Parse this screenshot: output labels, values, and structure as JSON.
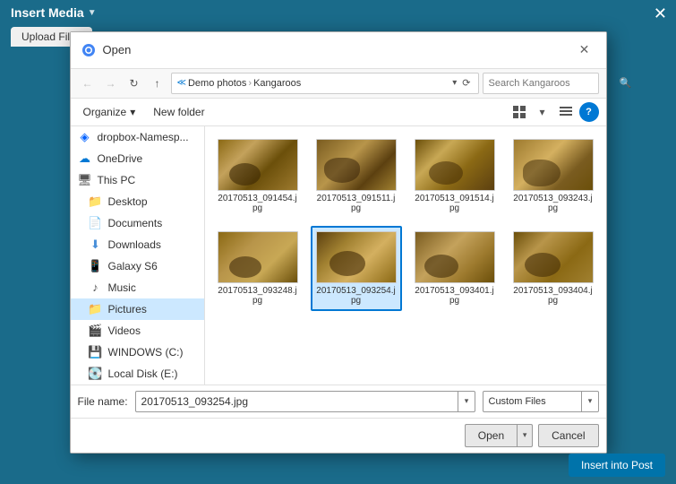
{
  "app": {
    "title": "Insert Media",
    "title_arrow": "▼",
    "close_label": "✕"
  },
  "dialog": {
    "title": "Open",
    "close_label": "✕",
    "nav": {
      "back_label": "←",
      "forward_label": "→",
      "recent_label": "↻",
      "up_label": "↑",
      "breadcrumbs": [
        "Demo photos",
        "Kangaroos"
      ],
      "search_placeholder": "Search Kangaroos",
      "refresh_label": "⟳"
    },
    "toolbar": {
      "organize_label": "Organize",
      "organize_arrow": "▾",
      "new_folder_label": "New folder",
      "view_grid_label": "⊞",
      "view_list_label": "☰",
      "help_label": "?"
    },
    "sidebar": {
      "items": [
        {
          "id": "dropbox",
          "icon": "dropbox",
          "label": "dropbox-Namesp..."
        },
        {
          "id": "onedrive",
          "icon": "onedrive",
          "label": "OneDrive"
        },
        {
          "id": "this-pc",
          "icon": "pc",
          "label": "This PC",
          "is_parent": true
        },
        {
          "id": "desktop",
          "icon": "folder",
          "label": "Desktop",
          "indent": true
        },
        {
          "id": "documents",
          "icon": "folder-doc",
          "label": "Documents",
          "indent": true
        },
        {
          "id": "downloads",
          "icon": "folder-down",
          "label": "Downloads",
          "indent": true
        },
        {
          "id": "galaxy-s6",
          "icon": "phone",
          "label": "Galaxy S6",
          "indent": true
        },
        {
          "id": "music",
          "icon": "music",
          "label": "Music",
          "indent": true
        },
        {
          "id": "pictures",
          "icon": "folder",
          "label": "Pictures",
          "indent": true,
          "active": true
        },
        {
          "id": "videos",
          "icon": "video",
          "label": "Videos",
          "indent": true
        },
        {
          "id": "windows-c",
          "icon": "drive",
          "label": "WINDOWS (C:)",
          "indent": true
        },
        {
          "id": "local-disk-e",
          "icon": "drive",
          "label": "Local Disk (E:)",
          "indent": true
        }
      ]
    },
    "files": [
      {
        "id": "f1",
        "name": "20170513_091454.jpg",
        "thumb_class": "thumb-1"
      },
      {
        "id": "f2",
        "name": "20170513_091511.jpg",
        "thumb_class": "thumb-2"
      },
      {
        "id": "f3",
        "name": "20170513_091514.jpg",
        "thumb_class": "thumb-3"
      },
      {
        "id": "f4",
        "name": "20170513_093243.jpg",
        "thumb_class": "thumb-4"
      },
      {
        "id": "f5",
        "name": "20170513_093248.jpg",
        "thumb_class": "thumb-5"
      },
      {
        "id": "f6",
        "name": "20170513_093254.jpg",
        "thumb_class": "thumb-6",
        "selected": true
      },
      {
        "id": "f7",
        "name": "20170513_093401.jpg",
        "thumb_class": "thumb-7"
      },
      {
        "id": "f8",
        "name": "20170513_093404.jpg",
        "thumb_class": "thumb-8"
      }
    ],
    "bottom": {
      "filename_label": "File name:",
      "filename_value": "20170513_093254.jpg",
      "filetype_label": "Custom Files",
      "open_label": "Open",
      "cancel_label": "Cancel"
    }
  },
  "upload_tab": {
    "label": "Upload Files"
  },
  "insert_post_btn": "Insert into Post"
}
